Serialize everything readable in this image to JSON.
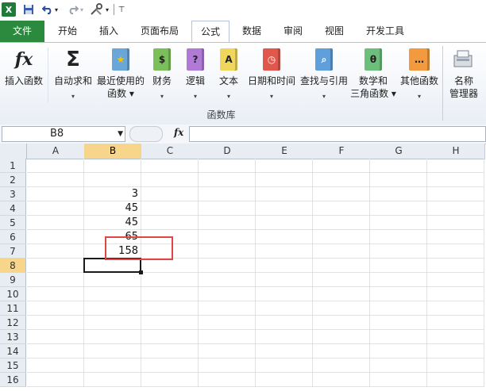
{
  "qat": {
    "logo": "X",
    "undo_caret": "▾",
    "redo_caret": "▾",
    "menu": "⊤"
  },
  "tabs": [
    {
      "label": "文件"
    },
    {
      "label": "开始"
    },
    {
      "label": "插入"
    },
    {
      "label": "页面布局"
    },
    {
      "label": "公式"
    },
    {
      "label": "数据"
    },
    {
      "label": "审阅"
    },
    {
      "label": "视图"
    },
    {
      "label": "开发工具"
    }
  ],
  "ribbon": {
    "buttons": [
      {
        "line1": "插入函数",
        "line2": ""
      },
      {
        "line1": "自动求和",
        "line2": "▾"
      },
      {
        "line1": "最近使用的",
        "line2": "函数 ▾"
      },
      {
        "line1": "财务",
        "line2": "▾"
      },
      {
        "line1": "逻辑",
        "line2": "▾"
      },
      {
        "line1": "文本",
        "line2": "▾"
      },
      {
        "line1": "日期和时间",
        "line2": "▾"
      },
      {
        "line1": "查找与引用",
        "line2": "▾"
      },
      {
        "line1": "数学和",
        "line2": "三角函数 ▾"
      },
      {
        "line1": "其他函数",
        "line2": "▾"
      },
      {
        "line1": "名称",
        "line2": "管理器"
      }
    ],
    "group_label": "函数库",
    "icon_chars": {
      "fx": "fx",
      "sigma": "Σ",
      "star": "★",
      "money": "$",
      "logic": "?",
      "text": "A",
      "date": "◷",
      "lookup": "⌕",
      "theta": "θ",
      "other": "…"
    }
  },
  "formula_bar": {
    "name_box": "B8",
    "fx_label": "fx",
    "formula": ""
  },
  "columns": [
    "A",
    "B",
    "C",
    "D",
    "E",
    "F",
    "G",
    "H"
  ],
  "rows": [
    "1",
    "2",
    "3",
    "4",
    "5",
    "6",
    "7",
    "8",
    "9",
    "10",
    "11",
    "12",
    "13",
    "14",
    "15",
    "16"
  ],
  "cells": {
    "B3": "3",
    "B4": "45",
    "B5": "45",
    "B6": "65",
    "B7": "158"
  }
}
